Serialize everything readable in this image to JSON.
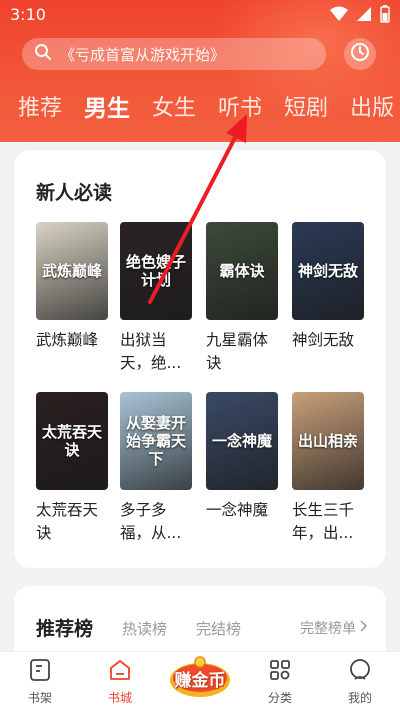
{
  "status": {
    "time": "3:10"
  },
  "search": {
    "placeholder": "《亏成首富从游戏开始》"
  },
  "tabs": [
    {
      "label": "推荐"
    },
    {
      "label": "男生"
    },
    {
      "label": "女生"
    },
    {
      "label": "听书"
    },
    {
      "label": "短剧"
    },
    {
      "label": "出版"
    }
  ],
  "new_reader": {
    "title": "新人必读",
    "books": [
      {
        "title": "武炼巅峰",
        "cover_text": "武炼巅峰",
        "cover_color": "#d9d4c4"
      },
      {
        "title": "出狱当天，绝...",
        "cover_text": "绝色嫂子计划",
        "cover_color": "#2a2326"
      },
      {
        "title": "九星霸体诀",
        "cover_text": "霸体诀",
        "cover_color": "#3d4a3a"
      },
      {
        "title": "神剑无敌",
        "cover_text": "神剑无敌",
        "cover_color": "#2b3a55"
      },
      {
        "title": "太荒吞天诀",
        "cover_text": "太荒吞天诀",
        "cover_color": "#2a2020"
      },
      {
        "title": "多子多福，从...",
        "cover_text": "从娶妻开始争霸天下",
        "cover_color": "#a8c4d6"
      },
      {
        "title": "一念神魔",
        "cover_text": "一念神魔",
        "cover_color": "#3a4a66"
      },
      {
        "title": "长生三千年，出...",
        "cover_text": "出山相亲",
        "cover_color": "#c9a07a"
      }
    ]
  },
  "ranking": {
    "title": "推荐榜",
    "tabs": [
      "热读榜",
      "完结榜"
    ],
    "more": "完整榜单"
  },
  "bottom_nav": {
    "items": [
      {
        "label": "书架",
        "icon": "bookshelf-icon"
      },
      {
        "label": "书城",
        "icon": "bookstore-icon"
      },
      {
        "label": "分类",
        "icon": "category-icon"
      },
      {
        "label": "我的",
        "icon": "profile-icon"
      }
    ],
    "earn_label": "赚金币"
  },
  "colors": {
    "accent": "#e8432c",
    "header": "#f0432e"
  }
}
